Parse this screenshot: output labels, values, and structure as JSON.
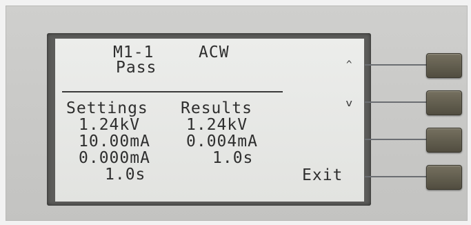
{
  "lcd": {
    "header_step": "M1-1",
    "header_mode": "ACW",
    "status": "Pass",
    "col_settings": "Settings",
    "col_results": "Results",
    "settings": [
      "1.24kV",
      "10.00mA",
      "0.000mA",
      "1.0s"
    ],
    "results": [
      "1.24kV",
      "0.004mA",
      "1.0s"
    ],
    "up_glyph": "^",
    "down_glyph": "v",
    "exit_label": "Exit"
  }
}
